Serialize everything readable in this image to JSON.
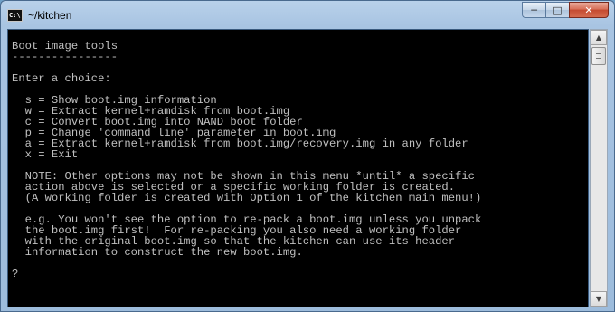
{
  "window": {
    "title": "~/kitchen",
    "icon_text": "C:\\",
    "minimize_glyph": "─",
    "maximize_glyph": "□",
    "close_glyph": "✕"
  },
  "console": {
    "lines": [
      "Boot image tools",
      "----------------",
      "",
      "Enter a choice:",
      "",
      "  s = Show boot.img information",
      "  w = Extract kernel+ramdisk from boot.img",
      "  c = Convert boot.img into NAND boot folder",
      "  p = Change 'command line' parameter in boot.img",
      "  a = Extract kernel+ramdisk from boot.img/recovery.img in any folder",
      "  x = Exit",
      "",
      "  NOTE: Other options may not be shown in this menu *until* a specific",
      "  action above is selected or a specific working folder is created.",
      "  (A working folder is created with Option 1 of the kitchen main menu!)",
      "",
      "  e.g. You won't see the option to re-pack a boot.img unless you unpack",
      "  the boot.img first!  For re-packing you also need a working folder",
      "  with the original boot.img so that the kitchen can use its header",
      "  information to construct the new boot.img.",
      "",
      "?"
    ]
  },
  "scrollbar": {
    "up_glyph": "▲",
    "down_glyph": "▼"
  }
}
